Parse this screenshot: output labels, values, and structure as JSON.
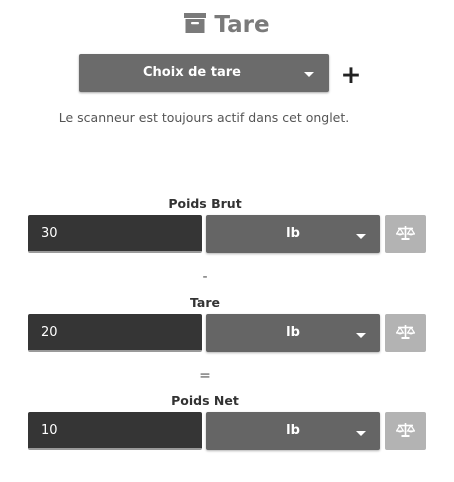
{
  "header": {
    "title": "Tare",
    "icon": "archive-box-icon"
  },
  "tare_select": {
    "label": "Choix de tare",
    "icon": "chevron-down-icon"
  },
  "add_button": {
    "label": "+",
    "icon": "plus-icon"
  },
  "hint": "Le scanneur est toujours actif dans cet onglet.",
  "gross": {
    "label": "Poids Brut",
    "value": "30",
    "unit": "lb",
    "scale_icon": "balance-scale-icon"
  },
  "minus_operator": "-",
  "tare": {
    "label": "Tare",
    "value": "20",
    "unit": "lb",
    "scale_icon": "balance-scale-icon"
  },
  "equals_operator": "=",
  "net": {
    "label": "Poids Net",
    "value": "10",
    "unit": "lb",
    "scale_icon": "balance-scale-icon"
  },
  "colors": {
    "title": "#7a7a7a",
    "button_dark": "#6b6b6b",
    "input_dark": "#353535",
    "scale_button": "#b3b3b3"
  }
}
